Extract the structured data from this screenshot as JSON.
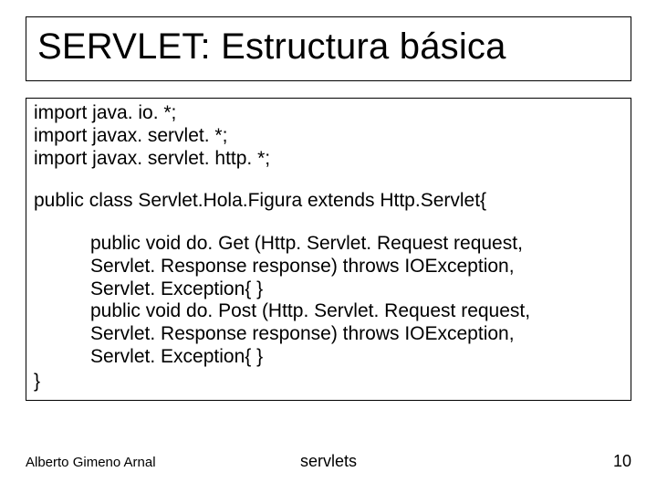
{
  "title": "SERVLET: Estructura básica",
  "imports": [
    "import java. io. *;",
    "import javax. servlet. *;",
    "import javax. servlet. http. *;"
  ],
  "classdecl": "public class Servlet.Hola.Figura extends Http.Servlet{",
  "methods": [
    "public void do. Get (Http. Servlet. Request request,",
    "Servlet. Response response) throws IOException,",
    "Servlet. Exception{        }",
    "public void do. Post (Http. Servlet. Request request,",
    "Servlet. Response response) throws IOException,",
    "Servlet. Exception{        }"
  ],
  "closebrace": "}",
  "footer": {
    "author": "Alberto Gimeno Arnal",
    "subject": "servlets",
    "page": "10"
  }
}
